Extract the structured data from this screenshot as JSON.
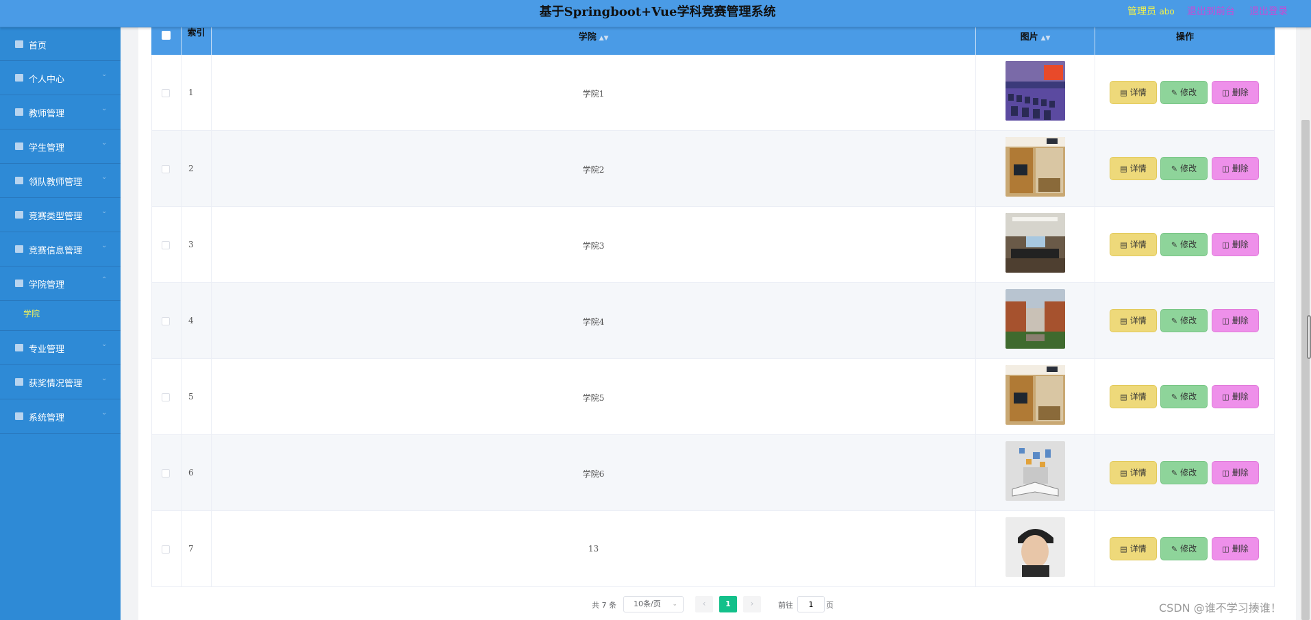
{
  "header": {
    "title": "基于Springboot+Vue学科竞赛管理系统",
    "role_label": "管理员",
    "username": "abo",
    "front_link": "退出到前台",
    "logout_link": "退出登录"
  },
  "sidebar": {
    "items": [
      {
        "label": "首页",
        "icon": "home-icon"
      },
      {
        "label": "个人中心",
        "icon": "user-icon"
      },
      {
        "label": "教师管理",
        "icon": "monitor-icon"
      },
      {
        "label": "学生管理",
        "icon": "chart-icon"
      },
      {
        "label": "领队教师管理",
        "icon": "group-icon"
      },
      {
        "label": "竞赛类型管理",
        "icon": "trophy-icon"
      },
      {
        "label": "竞赛信息管理",
        "icon": "monitor-icon"
      },
      {
        "label": "学院管理",
        "icon": "chat-icon"
      },
      {
        "label": "专业管理",
        "icon": "flag-icon"
      },
      {
        "label": "获奖情况管理",
        "icon": "clipboard-icon"
      },
      {
        "label": "系统管理",
        "icon": "settings-icon"
      }
    ],
    "submenu_label": "学院"
  },
  "table": {
    "headers": {
      "index": "索引",
      "college": "学院",
      "image": "图片",
      "actions": "操作"
    },
    "rows": [
      {
        "index": "1",
        "name": "学院1"
      },
      {
        "index": "2",
        "name": "学院2"
      },
      {
        "index": "3",
        "name": "学院3"
      },
      {
        "index": "4",
        "name": "学院4"
      },
      {
        "index": "5",
        "name": "学院5"
      },
      {
        "index": "6",
        "name": "学院6"
      },
      {
        "index": "7",
        "name": "13"
      }
    ],
    "actions": {
      "detail": "详情",
      "edit": "修改",
      "delete": "删除"
    }
  },
  "pagination": {
    "total": "共 7 条",
    "page_size": "10条/页",
    "current_page": "1",
    "goto_label": "前往",
    "goto_value": "1",
    "page_suffix": "页"
  },
  "watermark": "CSDN @谁不学习揍谁！",
  "colors": {
    "header_bg": "#4a9be6",
    "sidebar_bg": "#2e8ad6",
    "active_submenu": "#f3f35a",
    "detail_btn": "#eed97a",
    "edit_btn": "#8ed49a",
    "delete_btn": "#ee90ea",
    "page_active": "#13c08a"
  }
}
